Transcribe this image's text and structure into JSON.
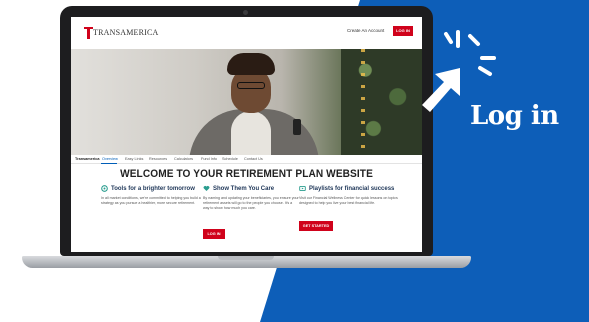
{
  "colors": {
    "brand_red": "#d0021b",
    "bg_blue": "#0d5eb8",
    "nav_active": "#005eb8"
  },
  "header": {
    "logo": "TRANSAMERICA",
    "create_account": "Create An Account",
    "login_button": "LOG IN"
  },
  "nav": {
    "brand": "Transamerica",
    "items": [
      "Overview",
      "Easy Links",
      "Resources",
      "Calculators",
      "Fund Info",
      "Schedule",
      "Contact Us"
    ]
  },
  "welcome": "WELCOME TO YOUR RETIREMENT PLAN WEBSITE",
  "columns": [
    {
      "icon": "tools-icon",
      "title": "Tools for a brighter tomorrow",
      "desc": "In all market conditions, we're committed to helping you build a strategy as you pursue a healthier, more secure retirement.",
      "button": ""
    },
    {
      "icon": "heart-hands-icon",
      "title": "Show Them You Care",
      "desc": "By naming and updating your beneficiaries, you ensure your retirement assets will go to the people you choose. It's a way to show how much you care.",
      "button": "LOG IN"
    },
    {
      "icon": "playlist-icon",
      "title": "Playlists for financial success",
      "desc": "Visit our Financial Wellness Center for quick lessons on topics designed to help you live your best financial life.",
      "button": "GET STARTED"
    }
  ],
  "callout": {
    "text": "Log in",
    "icon": "cursor-click-icon"
  }
}
